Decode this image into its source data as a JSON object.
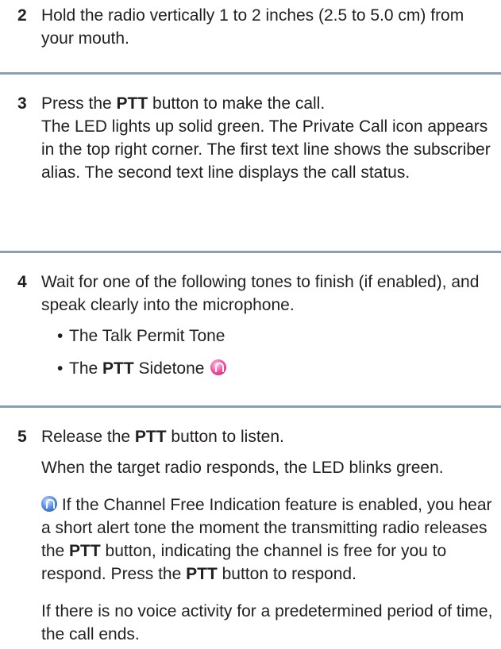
{
  "steps": [
    {
      "number": "2",
      "text": "Hold the radio vertically 1 to 2 inches (2.5 to 5.0 cm) from your mouth."
    },
    {
      "number": "3",
      "action_pre": "Press the ",
      "action_bold": "PTT",
      "action_post": " button to make the call.",
      "result": "The LED lights up solid green. The Private Call icon appears in the top right corner. The first text line shows the subscriber alias. The second text line displays the call status."
    },
    {
      "number": "4",
      "text": "Wait for one of the following tones to finish (if enabled), and speak clearly into the microphone.",
      "bullet_char": "•",
      "bullets": [
        {
          "text": "The Talk Permit Tone"
        },
        {
          "bold": "PTT",
          "text": " Sidetone",
          "pre": "The ",
          "icon": "sidetone-icon"
        }
      ]
    },
    {
      "number": "5",
      "action_pre": "Release the ",
      "action_bold": "PTT",
      "action_post": " button to listen.",
      "result": "When the target radio responds, the LED blinks green.",
      "note_icon": "note-icon",
      "note_pre": " If the Channel Free Indication feature is enabled, you hear a short alert tone the moment the transmitting radio releases the ",
      "note_bold1": "PTT",
      "note_mid": " button, indicating the channel is free for you to respond. Press the ",
      "note_bold2": "PTT",
      "note_post": " button to respond.",
      "final": "If there is no voice activity for a predetermined period of time, the call ends."
    }
  ]
}
